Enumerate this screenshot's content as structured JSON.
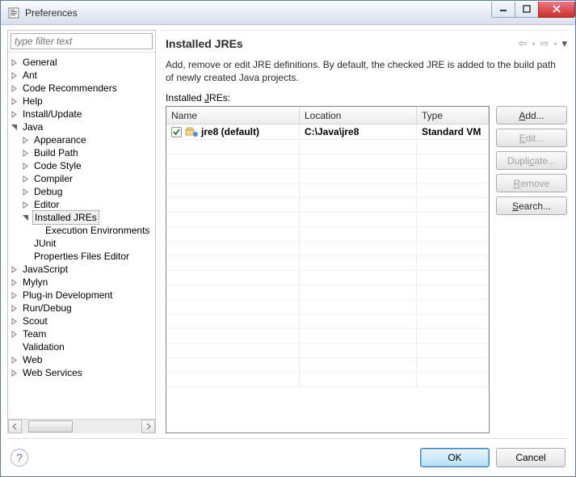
{
  "window": {
    "title": "Preferences"
  },
  "filter": {
    "placeholder": "type filter text"
  },
  "tree": {
    "items": [
      {
        "label": "General",
        "expand": "closed"
      },
      {
        "label": "Ant",
        "expand": "closed"
      },
      {
        "label": "Code Recommenders",
        "expand": "closed"
      },
      {
        "label": "Help",
        "expand": "closed"
      },
      {
        "label": "Install/Update",
        "expand": "closed"
      },
      {
        "label": "Java",
        "expand": "open",
        "children": [
          {
            "label": "Appearance",
            "expand": "closed"
          },
          {
            "label": "Build Path",
            "expand": "closed"
          },
          {
            "label": "Code Style",
            "expand": "closed"
          },
          {
            "label": "Compiler",
            "expand": "closed"
          },
          {
            "label": "Debug",
            "expand": "closed"
          },
          {
            "label": "Editor",
            "expand": "closed"
          },
          {
            "label": "Installed JREs",
            "expand": "open",
            "selected": true,
            "children": [
              {
                "label": "Execution Environments",
                "expand": "none"
              }
            ]
          },
          {
            "label": "JUnit",
            "expand": "none"
          },
          {
            "label": "Properties Files Editor",
            "expand": "none"
          }
        ]
      },
      {
        "label": "JavaScript",
        "expand": "closed"
      },
      {
        "label": "Mylyn",
        "expand": "closed"
      },
      {
        "label": "Plug-in Development",
        "expand": "closed"
      },
      {
        "label": "Run/Debug",
        "expand": "closed"
      },
      {
        "label": "Scout",
        "expand": "closed"
      },
      {
        "label": "Team",
        "expand": "closed"
      },
      {
        "label": "Validation",
        "expand": "none"
      },
      {
        "label": "Web",
        "expand": "closed"
      },
      {
        "label": "Web Services",
        "expand": "closed"
      }
    ]
  },
  "page": {
    "title": "Installed JREs",
    "description": "Add, remove or edit JRE definitions. By default, the checked JRE is added to the build path of newly created Java projects.",
    "section_label": "Installed JREs:",
    "table": {
      "columns": {
        "name": "Name",
        "location": "Location",
        "type": "Type"
      },
      "rows": [
        {
          "checked": true,
          "name": "jre8 (default)",
          "location": "C:\\Java\\jre8",
          "type": "Standard VM"
        }
      ]
    },
    "buttons": {
      "add": "Add...",
      "edit": "Edit...",
      "duplicate": "Duplicate...",
      "remove": "Remove",
      "search": "Search..."
    }
  },
  "bottom": {
    "ok": "OK",
    "cancel": "Cancel"
  }
}
